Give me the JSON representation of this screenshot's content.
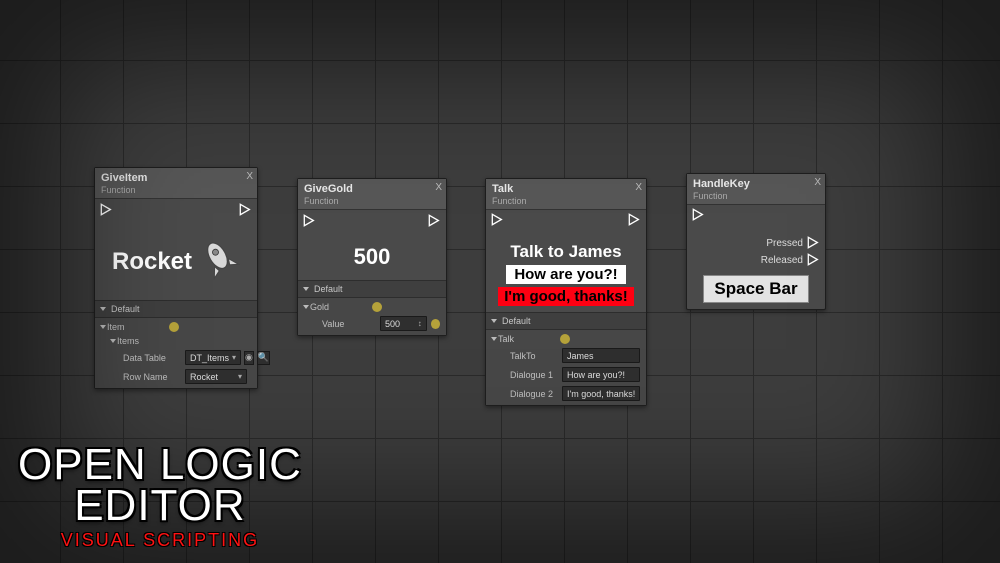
{
  "overlay": {
    "line1": "OPEN LOGIC",
    "line2": "EDITOR",
    "sub": "VISUAL SCRIPTING"
  },
  "nodes": {
    "giveItem": {
      "title": "GiveItem",
      "subtitle": "Function",
      "preview_text": "Rocket",
      "section": "Default",
      "props": {
        "item_label": "Item",
        "items_label": "Items",
        "data_table_label": "Data Table",
        "data_table_value": "DT_Items",
        "row_name_label": "Row Name",
        "row_name_value": "Rocket"
      }
    },
    "giveGold": {
      "title": "GiveGold",
      "subtitle": "Function",
      "preview_text": "500",
      "section": "Default",
      "props": {
        "gold_label": "Gold",
        "value_label": "Value",
        "value_value": "500"
      }
    },
    "talk": {
      "title": "Talk",
      "subtitle": "Function",
      "preview": {
        "line1": "Talk to James",
        "line2": "How are you?!",
        "line3": "I'm good, thanks!"
      },
      "section": "Default",
      "props": {
        "talk_label": "Talk",
        "talk_to_label": "TalkTo",
        "talk_to_value": "James",
        "dialogue1_label": "Dialogue 1",
        "dialogue1_value": "How are you?!",
        "dialogue2_label": "Dialogue 2",
        "dialogue2_value": "I'm good, thanks!"
      }
    },
    "handleKey": {
      "title": "HandleKey",
      "subtitle": "Function",
      "outputs": {
        "pressed": "Pressed",
        "released": "Released"
      },
      "preview_text": "Space Bar"
    }
  }
}
